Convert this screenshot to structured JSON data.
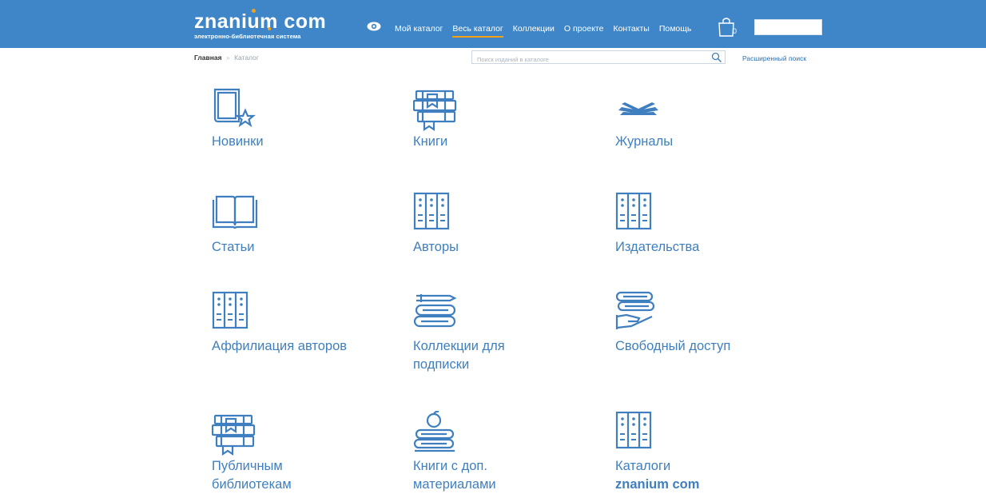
{
  "header": {
    "logo_main_pre": "znan",
    "logo_main_post": "um com",
    "logo_i": "i",
    "logo_sub": "электронно-библиотечная система",
    "cart_count": "0",
    "nav": [
      {
        "label": "Мой каталог",
        "active": false
      },
      {
        "label": "Весь каталог",
        "active": true
      },
      {
        "label": "Коллекции",
        "active": false
      },
      {
        "label": "О проекте",
        "active": false
      },
      {
        "label": "Контакты",
        "active": false
      },
      {
        "label": "Помощь",
        "active": false
      }
    ]
  },
  "breadcrumb": {
    "home": "Главная",
    "separator": "»",
    "current": "Каталог"
  },
  "search": {
    "placeholder": "Поиск изданий в каталоге",
    "advanced_label": "Расширенный поиск"
  },
  "catalog": {
    "items": [
      {
        "label": "Новинки",
        "icon": "book-star-icon"
      },
      {
        "label": "Книги",
        "icon": "books-stack-icon"
      },
      {
        "label": "Журналы",
        "icon": "open-book-icon"
      },
      {
        "label": "Статьи",
        "icon": "open-book-outline-icon"
      },
      {
        "label": "Авторы",
        "icon": "binders-icon"
      },
      {
        "label": "Издательства",
        "icon": "binders-icon"
      },
      {
        "label": "Аффилиация авторов",
        "icon": "binders-icon"
      },
      {
        "label": "Коллекции для подписки",
        "icon": "books-pen-icon"
      },
      {
        "label": "Свободный доступ",
        "icon": "books-hand-icon"
      },
      {
        "label": "Публичным библиотекам",
        "icon": "books-stack-icon"
      },
      {
        "label": "Книги с доп. материалами",
        "icon": "books-apple-icon"
      },
      {
        "label": "Каталоги",
        "label_line2": "znanium com",
        "icon": "binders-icon"
      }
    ]
  },
  "colors": {
    "header_bg": "#3f86c8",
    "accent": "#f5a015",
    "link": "#3f7fbf"
  }
}
